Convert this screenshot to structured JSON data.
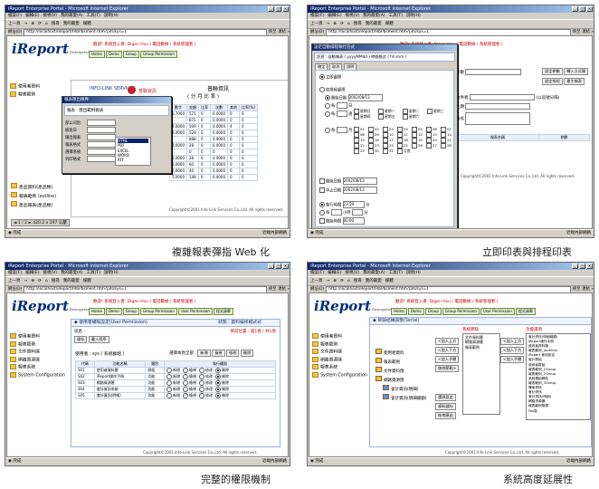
{
  "browser": {
    "title": "iReport Enterprise Portal - Microsoft Internet Explorer",
    "menus": [
      "檔案(F)",
      "編輯(E)",
      "檢視(V)",
      "我的最愛(A)",
      "工具(T)",
      "說明(H)"
    ],
    "toolbar": [
      "上一頁",
      "→",
      "⊗",
      "⟳",
      "⌂",
      "搜尋",
      "我的最愛",
      "媒體"
    ],
    "address_label": "網址(D)",
    "url": "http://localhost/iReport/IRbPbsment.htm?pdUsys=1",
    "go": "移至",
    "links": "連結 »",
    "status_left": "完成",
    "status_zone": "近端內部網路"
  },
  "brand": {
    "name": "iReport",
    "sub": "Enterprise Portal"
  },
  "user_line": "歡迎! 系統登入者: Digen Hsu ( 電話數據 / 系統管理者 )",
  "nav_tabs": [
    "Home",
    "Demo",
    "Group",
    "Group Permission",
    "User Permission",
    "程式清單"
  ],
  "sidebar": [
    "使用者資料",
    "報表範例",
    "文件資料匯",
    "網路資源匯",
    "報表系統",
    "System Configuration"
  ],
  "panels": {
    "report": {
      "caption": "複雜報表彈指 Web 化",
      "company": "INFO-LINK SERVICES",
      "company_cn": "普聯資訊",
      "report_title": "普聯資訊",
      "sub": "( 分 月 比 率 )",
      "dialog_title": "報表匯出條件",
      "dialog_header": "報表 : 匯出範例報表",
      "dialog_rows": [
        "部公司別",
        "檢查日",
        "匯出報表",
        "報表格式",
        "選擇系統",
        "列印格式"
      ],
      "options": [
        "HTML",
        "PDF",
        "EXCEL",
        "WORD",
        "RTF"
      ],
      "col_headers": [
        "數字",
        "金額",
        "比率",
        "次數",
        "其他",
        "比率(%)"
      ],
      "rows": [
        [
          "5,7000",
          "571",
          "0",
          "0.0000",
          "0",
          "0"
        ],
        [
          "",
          "871",
          "0",
          "0.0000",
          "0",
          "0"
        ],
        [
          "4,0000",
          "509",
          "0",
          "0.0000",
          "4",
          "0"
        ],
        [
          "3,0000",
          "529",
          "0",
          "0.0000",
          "0",
          "0"
        ],
        [
          "",
          "888",
          "0",
          "0.0000",
          "0",
          "0"
        ],
        [
          "2,0000",
          "28",
          "0",
          "0.0000",
          "0",
          "0"
        ],
        [
          "",
          "0",
          "0",
          "0",
          "0",
          "0"
        ],
        [
          "2,0000",
          "28",
          "0",
          "0.0000",
          "0",
          "0"
        ],
        [
          "5,0000",
          "60",
          "0",
          "0.0000",
          "0",
          "0"
        ],
        [
          "2,0000",
          "40",
          "0",
          "0.0000",
          "0",
          "0"
        ],
        [
          "5,0000",
          "148",
          "0",
          "0.0000",
          "0",
          "0"
        ]
      ],
      "side_items": [
        "產品資料(產品類)",
        "報表範例 (outline)",
        "產品報表(產品類)"
      ],
      "pager": "1 / 2",
      "zoom": "420.2 x 297 公釐",
      "footer": "Copyright©2001 Info-Link Services Co.,Ltd. All rights reserved."
    },
    "schedule": {
      "caption": "立即印表與排程印表",
      "dialog_title": "設定自動排程執行方式",
      "header": "訊息 : 自動報表 ( yyyyMMdd ) 時間格式 ( hh:mm )",
      "buttons": [
        "確定",
        "取消",
        "說明"
      ],
      "run_now": "立即處理",
      "by_schedule": "依排程處理",
      "every_day": "每",
      "days": "日",
      "weekly": "每",
      "weeks": "週",
      "monthly": "每",
      "months": "月",
      "weekdays": [
        "星期日",
        "星期一",
        "星期二",
        "星期三",
        "星期四",
        "星期五",
        "星期六"
      ],
      "month_days": [
        "01",
        "02",
        "03",
        "04",
        "05",
        "06",
        "07",
        "08",
        "09",
        "10",
        "11",
        "12",
        "13",
        "14",
        "15",
        "16",
        "17",
        "18",
        "19",
        "20",
        "21",
        "22",
        "23",
        "24",
        "25",
        "26",
        "27",
        "28",
        "29",
        "30",
        "31",
        "月底"
      ],
      "start_date_label": "開始日期",
      "end_date_label": "中止日期",
      "start_date": "2002/08/13",
      "end_date": "2002/08/13",
      "time_label": "執行時間",
      "time_value": "23:59",
      "every_label": "每",
      "hour": "小時",
      "minute": "分",
      "start_time_label": "開始時間",
      "start_time": "00:00",
      "right_buttons": [
        "設定參數",
        "轉入方式匯",
        "設定排程",
        "產生報表"
      ],
      "right_fields": [
        "參數",
        "收件者",
        "主題",
        "事件"
      ],
      "hint": "(以逗號分隔)",
      "param_headers": [
        "報表名稱",
        "參數"
      ],
      "footer": "Copyright©2001 Info-Link Services Co.,Ltd. All rights reserved."
    },
    "permission": {
      "caption": "完整的權限機制",
      "panel_title": "使用者權限設定(User Permission)",
      "status": "狀態 : 資料編修模式式",
      "message_label": "訊息 :",
      "total": "目前位置 : 第1頁 / 共1頁",
      "buttons": [
        "儲存",
        "載入程序"
      ],
      "user_line": "使用者 : sys ( 系統群組 )",
      "select_label": "選擇本頁全部 :",
      "select_buttons": [
        "新增",
        "檢視",
        "修改",
        "刪除"
      ],
      "headers": [
        "代碼",
        "功能名稱",
        "類別",
        "執行權限"
      ],
      "rows": [
        [
          "S01",
          "使用者資料匯",
          "群組"
        ],
        [
          "S02",
          "iReport操作手冊",
          "功能"
        ],
        [
          "S03",
          "網路資源匯",
          "功能"
        ],
        [
          "S04",
          "會計資訊系統",
          "功能"
        ],
        [
          "S05",
          "會計資訊(明細)",
          "功能"
        ]
      ],
      "perm_options": [
        "新增",
        "檢視",
        "修改",
        "刪除"
      ],
      "footer": "Copyright©2001 Info-Link Services Co.,Ltd. All rights reserved."
    },
    "extend": {
      "caption": "系統高度延展性",
      "panel_title": "目錄結構調整(Serial)",
      "tree": [
        "使用者資料",
        "報表範例",
        "文件資料匯",
        "網路資源匯",
        "會計資訊(明細)",
        "會計資訊(明細總額)"
      ],
      "move_buttons": [
        "<加入上方",
        "<加入下方",
        "<加入子層",
        "移除節點>"
      ],
      "sys_label": "系統節點",
      "sys_items": [
        "文件資料匯",
        "網路資源匯",
        "報表範例"
      ],
      "func_label": "功能選項",
      "func_items": [
        "會計資訊(明細總額)",
        "iReport操作手冊",
        "使用者資料匯",
        "報表範例_(outline)",
        "iReport 使用設定",
        "客戶群組",
        "使用者群組",
        "報表範例_1Group",
        "報表範例_2Group",
        "系統模組網站",
        "報表範例_3Group",
        "專案資訊",
        "會計資訊",
        "會計資訊(明細)",
        "網路資源匯",
        "報表範例管理",
        "Fax區"
      ],
      "right_buttons": [
        "<加入上方",
        "<加入下方",
        "<加入子層"
      ],
      "bottom_buttons": [
        "還原設定",
        "資料儲存",
        "結束匯出"
      ],
      "footer": "Copyright©2001 Info-Link Services Co.,Ltd. All rights reserved."
    }
  }
}
